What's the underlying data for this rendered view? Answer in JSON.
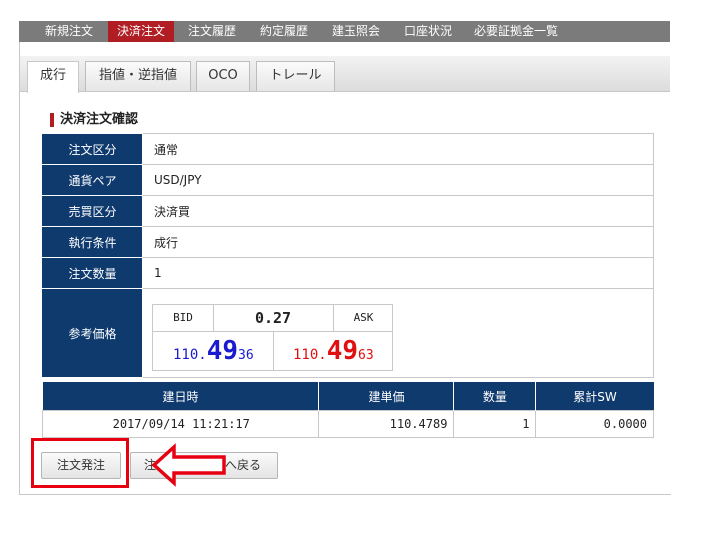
{
  "topnav": {
    "items": [
      "新規注文",
      "決済注文",
      "注文履歴",
      "約定履歴",
      "建玉照会",
      "口座状況",
      "必要証拠金一覧"
    ],
    "active": "決済注文"
  },
  "tabs": [
    "成行",
    "指値・逆指値",
    "OCO",
    "トレール"
  ],
  "section_title": "決済注文確認",
  "confirm": {
    "rows": [
      {
        "label": "注文区分",
        "value": "通常"
      },
      {
        "label": "通貨ペア",
        "value": "USD/JPY"
      },
      {
        "label": "売買区分",
        "value": "決済買"
      },
      {
        "label": "執行条件",
        "value": "成行"
      },
      {
        "label": "注文数量",
        "value": "1"
      }
    ],
    "price_label": "参考価格"
  },
  "quote": {
    "bid_label": "BID",
    "ask_label": "ASK",
    "spread": "0.27",
    "bid": {
      "a": "110.",
      "b": "49",
      "c": "36"
    },
    "ask": {
      "a": "110.",
      "b": "49",
      "c": "63"
    }
  },
  "positions": {
    "headers": [
      "建日時",
      "建単価",
      "数量",
      "累計SW"
    ],
    "rows": [
      [
        "2017/09/14 11:21:17",
        "110.4789",
        "1",
        "0.0000"
      ]
    ]
  },
  "buttons": {
    "submit": "注文発注",
    "partial_left": "注",
    "back": "へ戻る"
  },
  "colors": {
    "nav_bg": "#7b7b7b",
    "nav_active": "#b01d23",
    "table_header": "#0f3a6e",
    "bid": "#1a1ad0",
    "ask": "#e01010",
    "annotation": "#e60012"
  }
}
